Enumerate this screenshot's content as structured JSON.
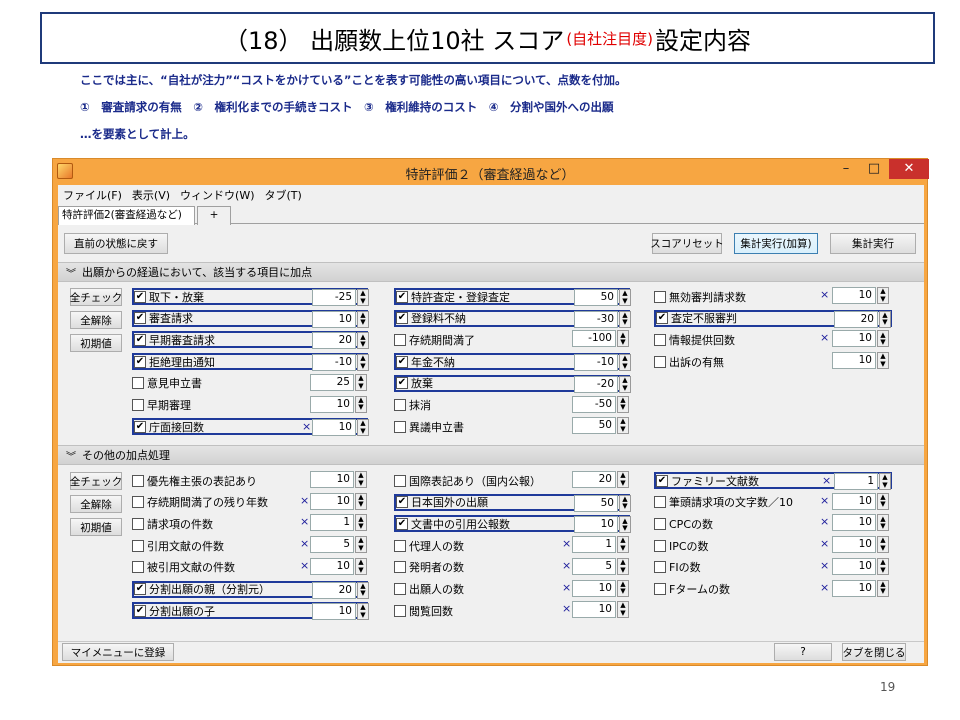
{
  "slide": {
    "title_main": "（18） 出願数上位10社 スコア",
    "title_note": "(自社注目度)",
    "title_tail": "設定内容",
    "intro_line1": "ここでは主に、“自社が注力”“コストをかけている”ことを表す可能性の高い項目について、点数を付加。",
    "intro_line2": "①　審査請求の有無　②　権利化までの手続きコスト　③　権利維持のコスト　④　分割や国外への出願",
    "intro_line3": "…を要素として計上。",
    "page_number": "19"
  },
  "window": {
    "title": "特許評価２（審査経過など）",
    "min": "–",
    "max": "□",
    "close": "✕"
  },
  "menu": [
    "ファイル(F)",
    "表示(V)",
    "ウィンドウ(W)",
    "タブ(T)"
  ],
  "tabs": {
    "active": "特許評価2(審査経過など)",
    "add": "+"
  },
  "toolbar": {
    "restore": "直前の状態に戻す",
    "score_reset": "スコアリセット",
    "run_add": "集計実行(加算)",
    "run": "集計実行"
  },
  "side_buttons": {
    "check_all": "全チェック",
    "uncheck_all": "全解除",
    "defaults": "初期値"
  },
  "section1": {
    "header": "出願からの経過において、該当する項目に加点",
    "col1": [
      {
        "label": "取下・放棄",
        "checked": true,
        "mult": "",
        "value": "-25",
        "hl": true
      },
      {
        "label": "審査請求",
        "checked": true,
        "mult": "",
        "value": "10",
        "hl": true
      },
      {
        "label": "早期審査請求",
        "checked": true,
        "mult": "",
        "value": "20",
        "hl": true
      },
      {
        "label": "拒絶理由通知",
        "checked": true,
        "mult": "",
        "value": "-10",
        "hl": true
      },
      {
        "label": "意見申立書",
        "checked": false,
        "mult": "",
        "value": "25",
        "hl": false
      },
      {
        "label": "早期審理",
        "checked": false,
        "mult": "",
        "value": "10",
        "hl": false
      },
      {
        "label": "庁面接回数",
        "checked": true,
        "mult": "×",
        "value": "10",
        "hl": true
      }
    ],
    "col2": [
      {
        "label": "特許査定・登録査定",
        "checked": true,
        "mult": "",
        "value": "50",
        "hl": true
      },
      {
        "label": "登録料不納",
        "checked": true,
        "mult": "",
        "value": "-30",
        "hl": true
      },
      {
        "label": "存続期間満了",
        "checked": false,
        "mult": "",
        "value": "-100",
        "hl": false
      },
      {
        "label": "年金不納",
        "checked": true,
        "mult": "",
        "value": "-10",
        "hl": true
      },
      {
        "label": "放棄",
        "checked": true,
        "mult": "",
        "value": "-20",
        "hl": true
      },
      {
        "label": "抹消",
        "checked": false,
        "mult": "",
        "value": "-50",
        "hl": false
      },
      {
        "label": "異議申立書",
        "checked": false,
        "mult": "",
        "value": "50",
        "hl": false
      }
    ],
    "col3": [
      {
        "label": "無効審判請求数",
        "checked": false,
        "mult": "×",
        "value": "10",
        "hl": false
      },
      {
        "label": "査定不服審判",
        "checked": true,
        "mult": "",
        "value": "20",
        "hl": true
      },
      {
        "label": "情報提供回数",
        "checked": false,
        "mult": "×",
        "value": "10",
        "hl": false
      },
      {
        "label": "出訴の有無",
        "checked": false,
        "mult": "",
        "value": "10",
        "hl": false
      }
    ]
  },
  "section2": {
    "header": "その他の加点処理",
    "col1": [
      {
        "label": "優先権主張の表記あり",
        "checked": false,
        "mult": "",
        "value": "10",
        "hl": false
      },
      {
        "label": "存続期間満了の残り年数",
        "checked": false,
        "mult": "×",
        "value": "10",
        "hl": false
      },
      {
        "label": "請求項の件数",
        "checked": false,
        "mult": "×",
        "value": "1",
        "hl": false
      },
      {
        "label": "引用文献の件数",
        "checked": false,
        "mult": "×",
        "value": "5",
        "hl": false
      },
      {
        "label": "被引用文献の件数",
        "checked": false,
        "mult": "×",
        "value": "10",
        "hl": false
      },
      {
        "label": "分割出願の親（分割元）",
        "checked": true,
        "mult": "",
        "value": "20",
        "hl": true
      },
      {
        "label": "分割出願の子",
        "checked": true,
        "mult": "",
        "value": "10",
        "hl": true
      }
    ],
    "col2": [
      {
        "label": "国際表記あり（国内公報）",
        "checked": false,
        "mult": "",
        "value": "20",
        "hl": false
      },
      {
        "label": "日本国外の出願",
        "checked": true,
        "mult": "",
        "value": "50",
        "hl": true
      },
      {
        "label": "文書中の引用公報数",
        "checked": true,
        "mult": "",
        "value": "10",
        "hl": true
      },
      {
        "label": "代理人の数",
        "checked": false,
        "mult": "×",
        "value": "1",
        "hl": false
      },
      {
        "label": "発明者の数",
        "checked": false,
        "mult": "×",
        "value": "5",
        "hl": false
      },
      {
        "label": "出願人の数",
        "checked": false,
        "mult": "×",
        "value": "10",
        "hl": false
      },
      {
        "label": "閲覧回数",
        "checked": false,
        "mult": "×",
        "value": "10",
        "hl": false
      }
    ],
    "col3": [
      {
        "label": "ファミリー文献数",
        "checked": true,
        "mult": "×",
        "value": "1",
        "hl": true
      },
      {
        "label": "筆頭請求項の文字数／10",
        "checked": false,
        "mult": "×",
        "value": "10",
        "hl": false
      },
      {
        "label": "CPCの数",
        "checked": false,
        "mult": "×",
        "value": "10",
        "hl": false
      },
      {
        "label": "IPCの数",
        "checked": false,
        "mult": "×",
        "value": "10",
        "hl": false
      },
      {
        "label": "FIの数",
        "checked": false,
        "mult": "×",
        "value": "10",
        "hl": false
      },
      {
        "label": "Fタームの数",
        "checked": false,
        "mult": "×",
        "value": "10",
        "hl": false
      }
    ]
  },
  "statusbar": {
    "register": "マイメニューに登録",
    "help": "?",
    "close_tab": "タブを閉じる"
  }
}
